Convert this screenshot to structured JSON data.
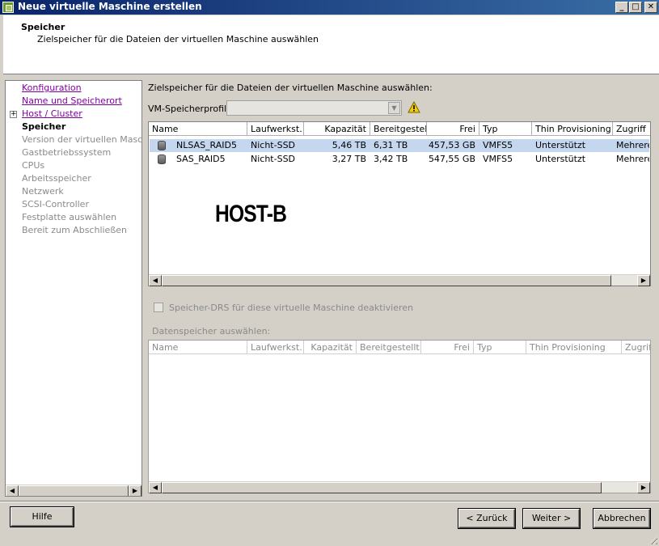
{
  "window": {
    "title": "Neue virtuelle Maschine erstellen",
    "minimize_glyph": "_",
    "maximize_glyph": "□",
    "close_glyph": "✕"
  },
  "header": {
    "title": "Speicher",
    "subtitle": "Zielspeicher für die Dateien der virtuellen Maschine auswählen"
  },
  "nav": {
    "items": [
      {
        "label": "Konfiguration",
        "state": "link"
      },
      {
        "label": "Name und Speicherort",
        "state": "link"
      },
      {
        "label": "Host / Cluster",
        "state": "link",
        "expander": "+"
      },
      {
        "label": "Speicher",
        "state": "current"
      },
      {
        "label": "Version der virtuellen Maschine",
        "state": "disabled"
      },
      {
        "label": "Gastbetriebssystem",
        "state": "disabled"
      },
      {
        "label": "CPUs",
        "state": "disabled"
      },
      {
        "label": "Arbeitsspeicher",
        "state": "disabled"
      },
      {
        "label": "Netzwerk",
        "state": "disabled"
      },
      {
        "label": "SCSI-Controller",
        "state": "disabled"
      },
      {
        "label": "Festplatte auswählen",
        "state": "disabled"
      },
      {
        "label": "Bereit zum Abschließen",
        "state": "disabled"
      }
    ]
  },
  "main": {
    "instruction": "Zielspeicher für die Dateien der virtuellen Maschine auswählen:",
    "profile_label": "VM-Speicherprofil:",
    "profile_value": "",
    "warning_icon": "warning-icon",
    "datastore_table": {
      "columns": [
        "Name",
        "Laufwerkst...",
        "Kapazität",
        "Bereitgestel...",
        "Frei",
        "Typ",
        "Thin Provisioning",
        "Zugriff"
      ],
      "rows": [
        {
          "name": "NLSAS_RAID5",
          "drive": "Nicht-SSD",
          "capacity": "5,46 TB",
          "provisioned": "6,31 TB",
          "free": "457,53 GB",
          "type": "VMFS5",
          "thin": "Unterstützt",
          "access": "Mehrere",
          "selected": true
        },
        {
          "name": "SAS_RAID5",
          "drive": "Nicht-SSD",
          "capacity": "3,27 TB",
          "provisioned": "3,42 TB",
          "free": "547,55 GB",
          "type": "VMFS5",
          "thin": "Unterstützt",
          "access": "Mehrere",
          "selected": false
        }
      ]
    },
    "overlay_text": "HOST-B",
    "sdrs_checkbox_label": "Speicher-DRS für diese virtuelle Maschine deaktivieren",
    "sdrs_checked": false,
    "datastore_select_label": "Datenspeicher auswählen:",
    "second_table": {
      "columns": [
        "Name",
        "Laufwerkst...",
        "Kapazität",
        "Bereitgestellt",
        "Frei",
        "Typ",
        "Thin Provisioning",
        "Zugriff"
      ]
    }
  },
  "footer": {
    "help": "Hilfe",
    "back": "< Zurück",
    "next": "Weiter >",
    "cancel": "Abbrechen"
  },
  "icons": {
    "scroll_left": "◀",
    "scroll_right": "▶",
    "combo_arrow": "▼"
  }
}
